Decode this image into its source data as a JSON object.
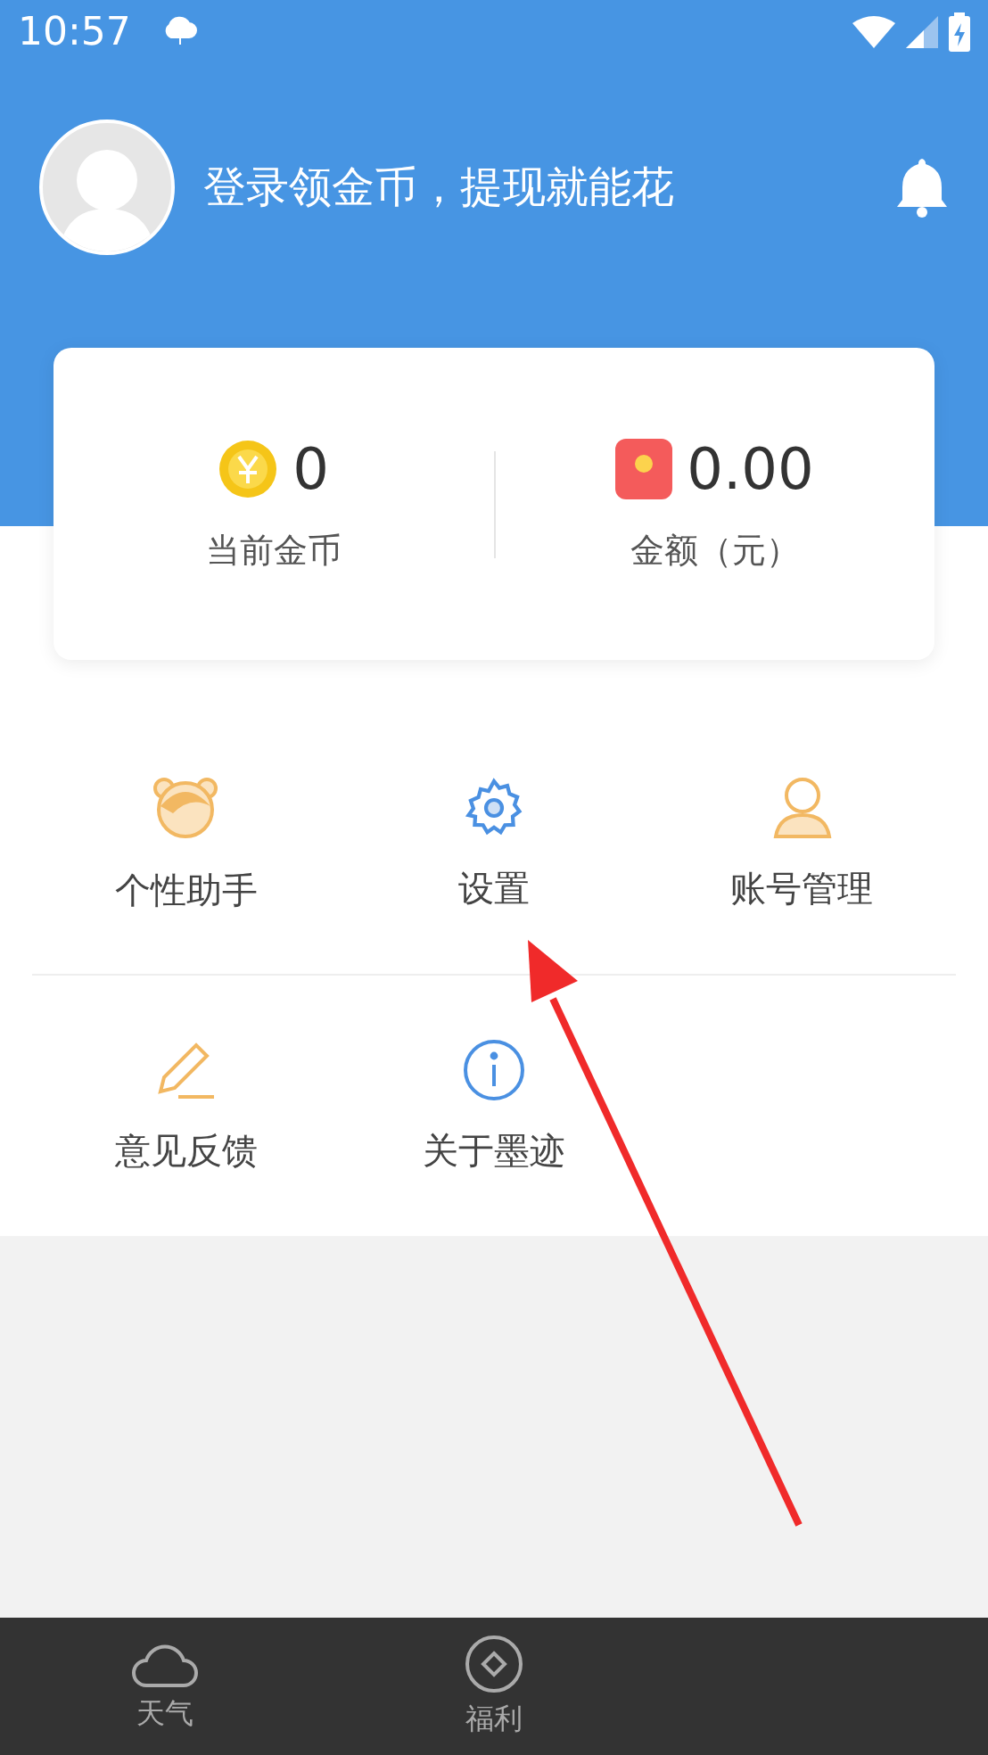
{
  "status_bar": {
    "time": "10:57"
  },
  "header": {
    "prompt": "登录领金币，提现就能花"
  },
  "wallet": [
    {
      "kind": "coin",
      "value": "0",
      "label": "当前金币"
    },
    {
      "kind": "cash",
      "value": "0.00",
      "label": "金额（元）"
    }
  ],
  "menu": [
    {
      "kind": "assistant",
      "label": "个性助手"
    },
    {
      "kind": "settings",
      "label": "设置"
    },
    {
      "kind": "account",
      "label": "账号管理"
    },
    {
      "kind": "feedback",
      "label": "意见反馈"
    },
    {
      "kind": "about",
      "label": "关于墨迹"
    }
  ],
  "bottom_nav": [
    {
      "kind": "weather",
      "label": "天气"
    },
    {
      "kind": "welfare",
      "label": "福利"
    }
  ]
}
